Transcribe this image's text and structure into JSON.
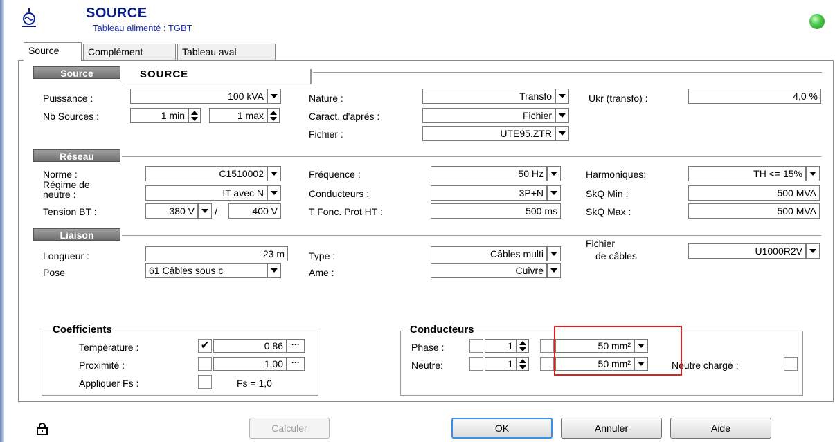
{
  "header": {
    "title": "SOURCE",
    "subtitle": "Tableau alimenté : TGBT",
    "status_color": "#3cbf3c"
  },
  "tabs": [
    "Source",
    "Complément",
    "Tableau aval"
  ],
  "source": {
    "section_label": "Source",
    "name": "SOURCE",
    "puissance_label": "Puissance :",
    "puissance": "100 kVA",
    "nb_sources_label": "Nb Sources :",
    "nb_min": "1 min",
    "nb_max": "1 max",
    "nature_label": "Nature :",
    "nature": "Transfo",
    "caract_label": "Caract. d'après :",
    "caract": "Fichier",
    "fichier_label": "Fichier :",
    "fichier": "UTE95.ZTR",
    "ukr_label": "Ukr (transfo) :",
    "ukr": "4,0 %"
  },
  "reseau": {
    "section_label": "Réseau",
    "norme_label": "Norme :",
    "norme": "C1510002",
    "regime_label_1": "Régime de",
    "regime_label_2": "neutre :",
    "regime": "IT avec N",
    "tension_label": "Tension BT :",
    "tension_1": "380 V",
    "tension_sep": "/",
    "tension_2": "400 V",
    "frequence_label": "Fréquence :",
    "frequence": "50 Hz",
    "conducteurs_label": "Conducteurs :",
    "conducteurs": "3P+N",
    "tfonc_label": "T Fonc. Prot HT :",
    "tfonc": "500 ms",
    "harmoniques_label": "Harmoniques:",
    "harmoniques": "TH <= 15%",
    "skq_min_label": "SkQ Min :",
    "skq_min": "500 MVA",
    "skq_max_label": "SkQ Max :",
    "skq_max": "500 MVA"
  },
  "liaison": {
    "section_label": "Liaison",
    "longueur_label": "Longueur :",
    "longueur": "23 m",
    "pose_label": "Pose",
    "pose": "61  Câbles sous c",
    "type_label": "Type :",
    "type": "Câbles multi",
    "ame_label": "Ame :",
    "ame": "Cuivre",
    "fichier_cables_label_1": "Fichier",
    "fichier_cables_label_2": "de câbles",
    "fichier_cables": "U1000R2V"
  },
  "coefficients": {
    "title": "Coefficients",
    "temperature_label": "Température :",
    "temperature_checked": "✔",
    "temperature": "0,86",
    "proximite_label": "Proximité :",
    "proximite": "1,00",
    "fs_label": "Appliquer Fs :",
    "fs_value": "Fs =  1,0",
    "ellipsis": "···"
  },
  "conducteurs": {
    "title": "Conducteurs",
    "phase_label": "Phase :",
    "phase_count": "1",
    "phase_section": "50 mm²",
    "neutre_label": "Neutre:",
    "neutre_count": "1",
    "neutre_section": "50 mm²",
    "neutre_charge_label": "Neutre chargé :"
  },
  "buttons": {
    "calculer": "Calculer",
    "ok": "OK",
    "annuler": "Annuler",
    "aide": "Aide"
  },
  "highlight_color": "#e01e1e"
}
